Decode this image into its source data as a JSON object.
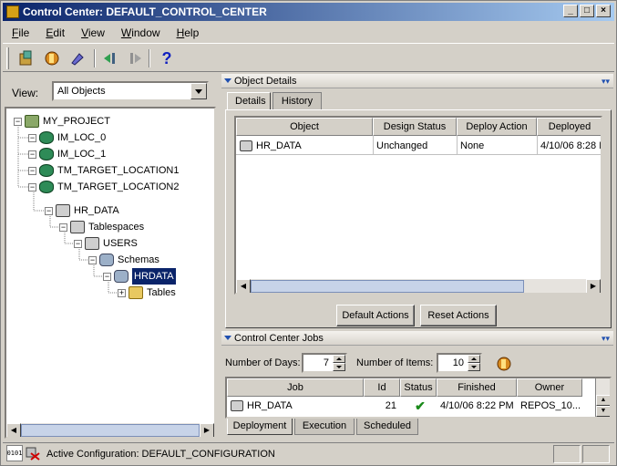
{
  "window": {
    "title": "Control Center: DEFAULT_CONTROL_CENTER"
  },
  "menu": [
    {
      "label": "File",
      "ul": "F",
      "rest": "ile"
    },
    {
      "label": "Edit",
      "ul": "E",
      "rest": "dit"
    },
    {
      "label": "View",
      "ul": "V",
      "rest": "iew"
    },
    {
      "label": "Window",
      "ul": "W",
      "rest": "indow"
    },
    {
      "label": "Help",
      "ul": "H",
      "rest": "elp"
    }
  ],
  "toolbar": {
    "help_glyph": "?"
  },
  "left": {
    "view_label": "View:",
    "view_value": "All Objects",
    "tree": [
      {
        "label": "MY_PROJECT"
      },
      {
        "label": "IM_LOC_0"
      },
      {
        "label": "IM_LOC_1"
      },
      {
        "label": "TM_TARGET_LOCATION1"
      },
      {
        "label": "TM_TARGET_LOCATION2"
      },
      {
        "label": "HR_DATA"
      },
      {
        "label": "Tablespaces"
      },
      {
        "label": "USERS"
      },
      {
        "label": "Schemas"
      },
      {
        "label": "HRDATA"
      },
      {
        "label": "Tables"
      }
    ]
  },
  "object_details": {
    "title": "Object Details",
    "tabs": [
      "Details",
      "History"
    ],
    "columns": [
      "Object",
      "Design Status",
      "Deploy Action",
      "Deployed"
    ],
    "rows": [
      {
        "object": "HR_DATA",
        "design_status": "Unchanged",
        "deploy_action": "None",
        "deployed": "4/10/06 8:28 P"
      }
    ],
    "default_actions": "Default Actions",
    "reset_actions": "Reset Actions"
  },
  "jobs": {
    "title": "Control Center Jobs",
    "days_label": "Number of Days:",
    "days_value": "7",
    "items_label": "Number of Items:",
    "items_value": "10",
    "columns": [
      "Job",
      "Id",
      "Status",
      "Finished",
      "Owner"
    ],
    "rows": [
      {
        "job": "HR_DATA",
        "id": "21",
        "status": "✔",
        "finished": "4/10/06 8:22 PM",
        "owner": "REPOS_10..."
      }
    ],
    "tabs": [
      "Deployment",
      "Execution",
      "Scheduled"
    ]
  },
  "status": {
    "text": "Active Configuration: DEFAULT_CONFIGURATION"
  }
}
